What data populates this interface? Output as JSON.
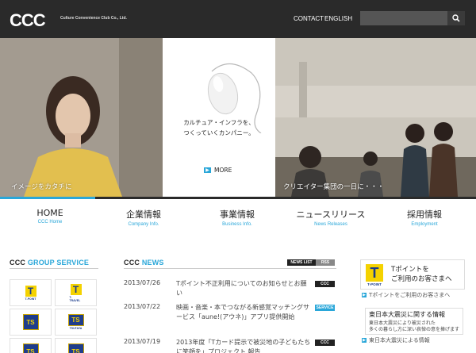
{
  "header": {
    "logo": "CCC",
    "company": "Culture Convenience Club Co., Ltd.",
    "links": [
      "CONTACT",
      "ENGLISH"
    ],
    "search_placeholder": ""
  },
  "hero": {
    "left_caption": "イメージをカタチに",
    "mid_line1": "カルチュア・インフラを、",
    "mid_line2": "つくっていくカンパニー。",
    "more_label": "MORE",
    "right_caption": "クリエイター集団の一日に・・・"
  },
  "nav": [
    {
      "jp": "HOME",
      "en": "CCC Home"
    },
    {
      "jp": "企業情報",
      "en": "Company Info."
    },
    {
      "jp": "事業情報",
      "en": "Business Info."
    },
    {
      "jp": "ニュースリリース",
      "en": "News Releases"
    },
    {
      "jp": "採用情報",
      "en": "Employment"
    }
  ],
  "group": {
    "title_a": "CCC ",
    "title_b": "GROUP SERVICE",
    "tiles": [
      {
        "type": "tpoint",
        "letter": "T",
        "caption": "T-POINT"
      },
      {
        "type": "tpoint",
        "letter": "T",
        "caption": "T-TRAVEL"
      },
      {
        "type": "tsutaya",
        "letter": "TS",
        "caption": ""
      },
      {
        "type": "tsutaya",
        "letter": "TS",
        "caption": "TSUTAYA"
      },
      {
        "type": "tsutaya",
        "letter": "TS",
        "caption": ""
      },
      {
        "type": "tsutaya",
        "letter": "TS",
        "caption": ""
      }
    ]
  },
  "news": {
    "title_a": "CCC ",
    "title_b": "NEWS",
    "list_label": "NEWS LIST",
    "rss_label": "RSS",
    "items": [
      {
        "date": "2013/07/26",
        "text": "Tポイント不正利用についてのお知らせとお願い",
        "badge": "CCC",
        "badge_color": "#222222"
      },
      {
        "date": "2013/07/22",
        "text": "映画・音楽・本でつながる新感覚マッチングサービス「aune!(アウネ)」アプリ提供開始",
        "badge": "SERVICE",
        "badge_color": "#2aa7d9"
      },
      {
        "date": "2013/07/19",
        "text": "2013年度「Tカード提示で被災地の子どもたちに笑顔を」プロジェクト 報告",
        "badge": "CCC",
        "badge_color": "#222222"
      }
    ]
  },
  "sidebar": {
    "tpoint_line1": "Tポイントを",
    "tpoint_line2": "ご利用のお客さまへ",
    "tpoint_link": "Tポイントをご利用のお客さまへ",
    "quake_title": "東日本大震災に関する情報",
    "quake_body1": "東日本大震災により被災された",
    "quake_body2": "多くの暮らし方に深い哀悼の意を捧げます",
    "quake_link": "東日本大震災による情報"
  },
  "colors": {
    "accent": "#2aa7d9",
    "topbar": "#2a2a2a"
  }
}
